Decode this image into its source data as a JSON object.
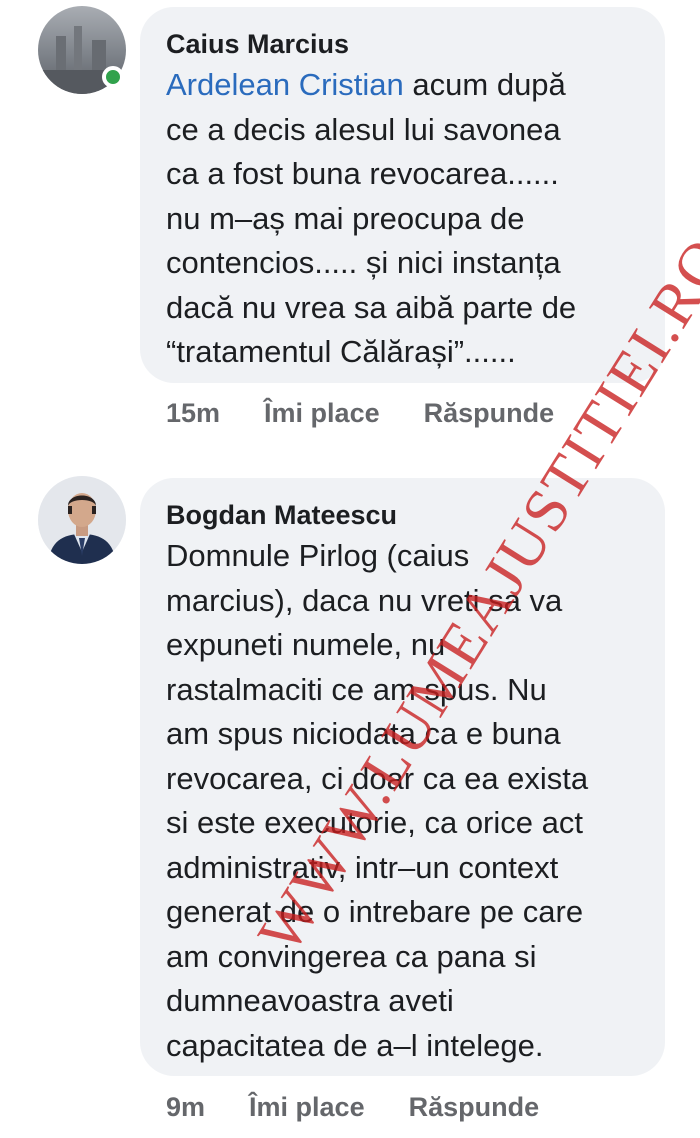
{
  "comments": [
    {
      "author": "Caius Marcius",
      "mention": "Ardelean Cristian",
      "lines_first": " acum după",
      "lines": [
        "ce a decis alesul lui savonea",
        "ca a fost buna revocarea......",
        "nu m–aș mai preocupa de",
        "contencios..... și nici instanța",
        "dacă nu vrea sa aibă parte de",
        "“tratamentul Călărași”......"
      ],
      "time": "15m",
      "like_label": "Îmi place",
      "reply_label": "Răspunde",
      "online": true
    },
    {
      "author": "Bogdan Mateescu",
      "lines": [
        "Domnule Pirlog (caius",
        "marcius), daca nu vreti sa va",
        "expuneti numele, nu",
        "rastalmaciti ce am spus. Nu",
        "am spus niciodata ca e buna",
        "revocarea, ci doar ca ea exista",
        "si este executorie, ca orice act",
        "administrativ, intr–un context",
        "generat de o intrebare pe care",
        "am convingerea ca pana si",
        "dumneavoastra aveti",
        "capacitatea de a–l intelege."
      ],
      "time": "9m",
      "like_label": "Îmi place",
      "reply_label": "Răspunde",
      "online": false
    }
  ],
  "watermark": "WWW.LUMEAJUSTITIEI.RO",
  "colors": {
    "bubble": "#f0f2f5",
    "mention": "#2a6bbd",
    "meta": "#65676b",
    "online": "#31a24c",
    "watermark": "#c81e1e"
  }
}
